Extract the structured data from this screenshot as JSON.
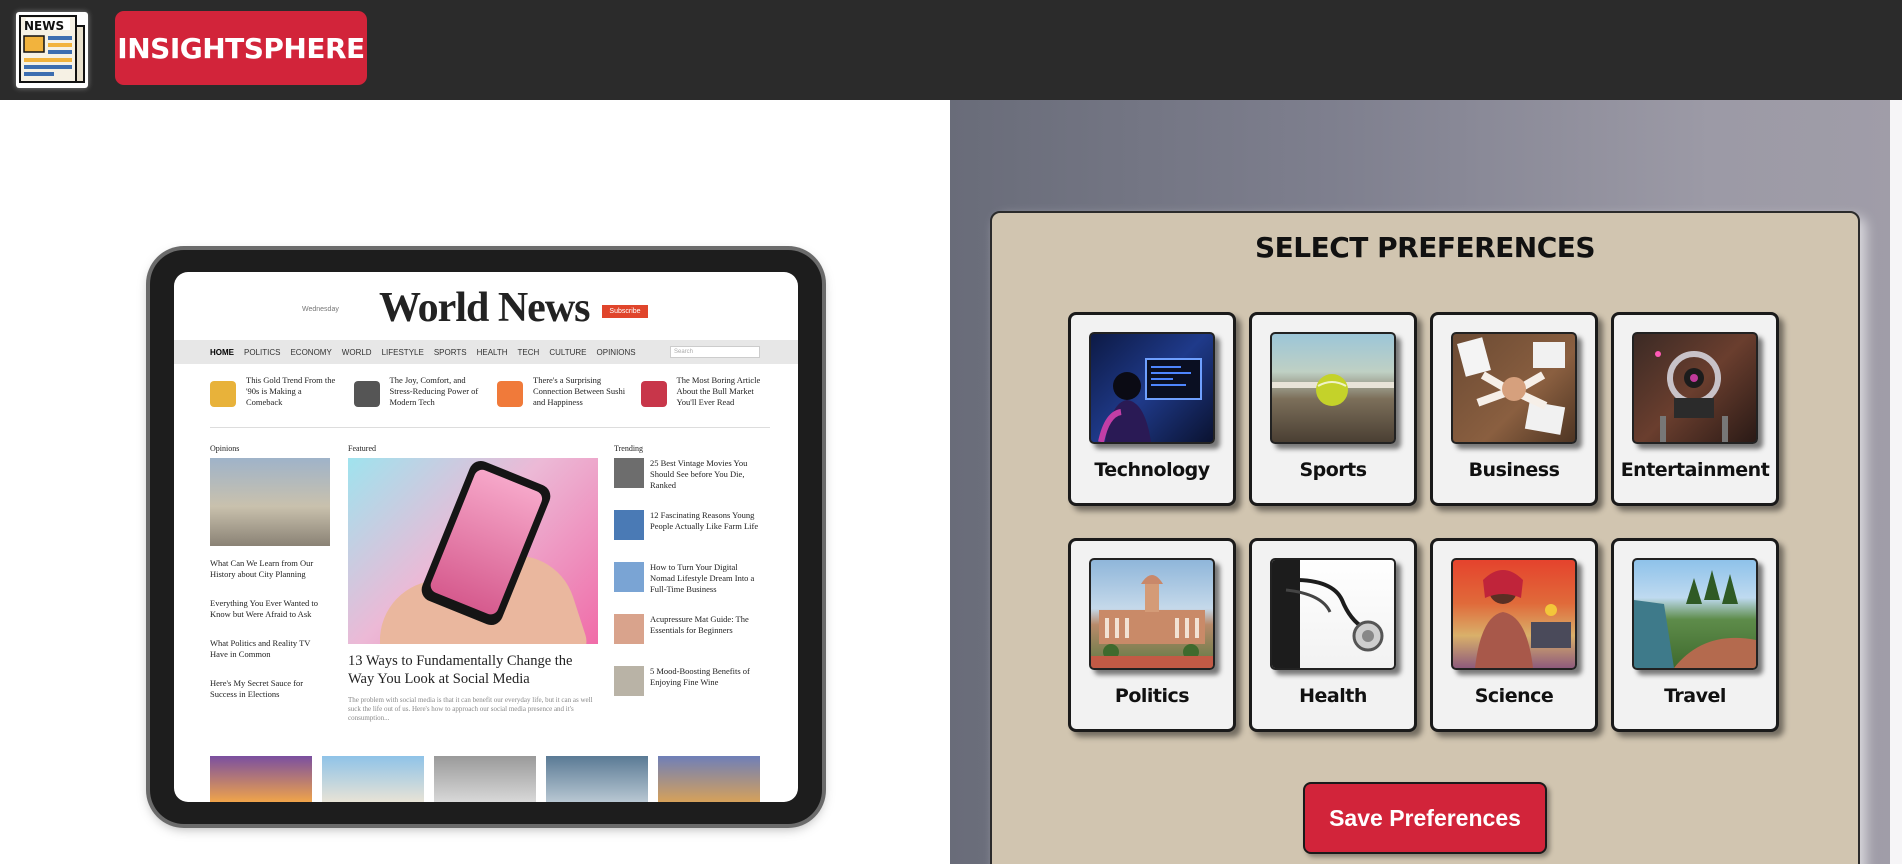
{
  "header": {
    "logo_icon": "newspaper-icon",
    "brand": "INSIGHTSPHERE",
    "brand_color": "#d2243a",
    "background": "#2b2b2b"
  },
  "hero": {
    "screen": {
      "masthead": "World News",
      "date": "Wednesday",
      "subscribe": "Subscribe",
      "nav": [
        "HOME",
        "POLITICS",
        "ECONOMY",
        "WORLD",
        "LIFESTYLE",
        "SPORTS",
        "HEALTH",
        "TECH",
        "CULTURE",
        "OPINIONS"
      ],
      "search_placeholder": "Search",
      "strip": [
        "This Gold Trend From the '90s is Making a Comeback",
        "The Joy, Comfort, and Stress-Reducing Power of Modern Tech",
        "There's a Surprising Connection Between Sushi and Happiness",
        "The Most Boring Article About the Bull Market You'll Ever Read"
      ],
      "opinions_heading": "Opinions",
      "featured_heading": "Featured",
      "trending_heading": "Trending",
      "opinions": [
        "What Can We Learn from Our History about City Planning",
        "Everything You Ever Wanted to Know but Were Afraid to Ask",
        "What Politics and Reality TV Have in Common",
        "Here's My Secret Sauce for Success in Elections"
      ],
      "featured_title": "13 Ways to Fundamentally Change the Way You Look at Social Media",
      "featured_text": "The problem with social media is that it can benefit our everyday life, but it can as well suck the life out of us. Here's how to approach our social media presence and it's consumption...",
      "trending": [
        "25 Best Vintage Movies You Should See before You Die, Ranked",
        "12 Fascinating Reasons Young People Actually Like Farm Life",
        "How to Turn Your Digital Nomad Lifestyle Dream Into a Full-Time Business",
        "Acupressure Mat Guide: The Essentials for Beginners",
        "5 Mood-Boosting Benefits of Enjoying Fine Wine"
      ]
    }
  },
  "preferences": {
    "title": "SELECT PREFERENCES",
    "panel_color": "#d1c5b0",
    "categories": [
      {
        "label": "Technology",
        "image": "technology-image"
      },
      {
        "label": "Sports",
        "image": "sports-image"
      },
      {
        "label": "Business",
        "image": "business-image"
      },
      {
        "label": "Entertainment",
        "image": "entertainment-image"
      },
      {
        "label": "Politics",
        "image": "politics-image"
      },
      {
        "label": "Health",
        "image": "health-image"
      },
      {
        "label": "Science",
        "image": "science-image"
      },
      {
        "label": "Travel",
        "image": "travel-image"
      }
    ],
    "save_label": "Save Preferences"
  }
}
